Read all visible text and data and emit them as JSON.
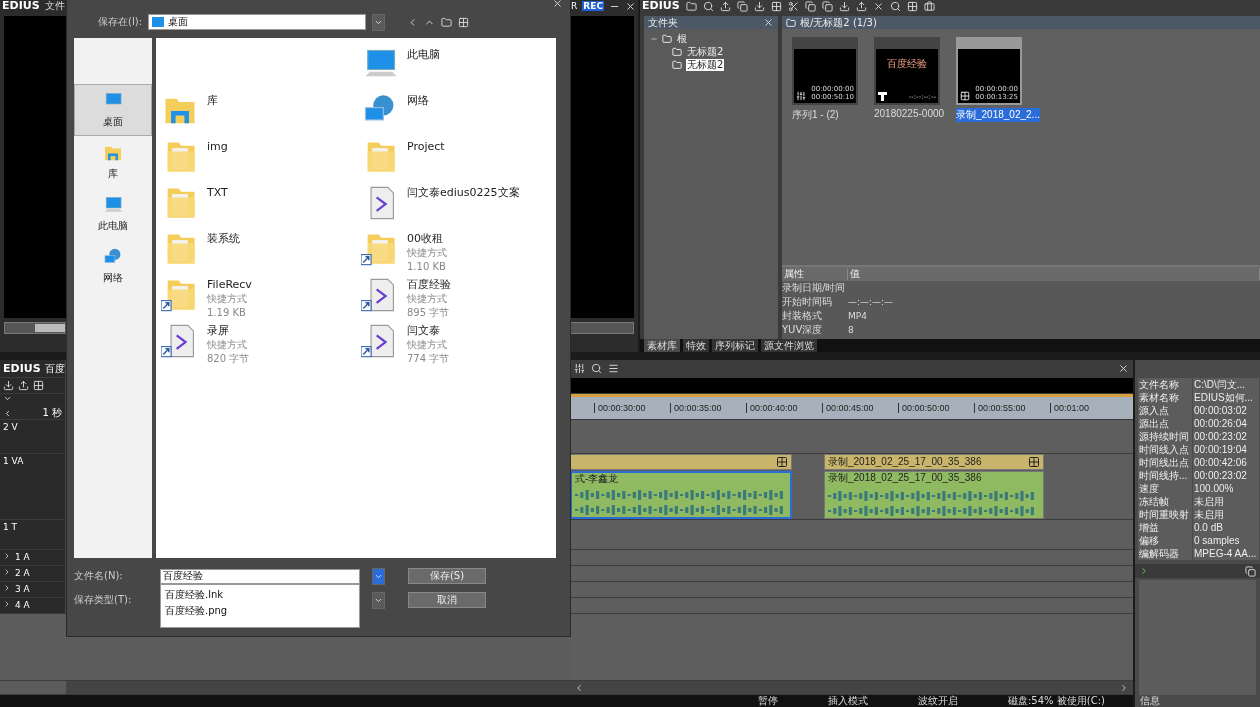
{
  "player": {
    "app_name": "EDIUS",
    "menu_label": "文件",
    "channel_label": "R",
    "rec_label": "REC"
  },
  "bin": {
    "app_name": "EDIUS",
    "folder_panel": {
      "title": "文件夹",
      "tree": [
        {
          "label": "根",
          "expanded": true,
          "selected": false,
          "children": [
            {
              "label": "无标题2",
              "selected": false
            },
            {
              "label": "无标题2",
              "selected": true
            }
          ]
        }
      ]
    },
    "path": "根/无标题2 (1/3)",
    "clips": [
      {
        "kind": "sequence",
        "name": "序列1 - (2)",
        "timecode_in": "00:00:00:00",
        "timecode_out": "00:00:50:10",
        "selected": false
      },
      {
        "kind": "title",
        "name": "20180225-0000",
        "caption": "百度经验",
        "timecode_out": "--:--:--:--",
        "selected": false
      },
      {
        "kind": "video",
        "name": "录制_2018_02_2...",
        "timecode_in": "00:00:00:00",
        "timecode_out": "00:00:13:25",
        "selected": true
      }
    ],
    "properties": {
      "columns": [
        "属性",
        "值"
      ],
      "rows": [
        {
          "name": "录制日期/时间"
        },
        {
          "name": "开始时间码",
          "value": "—:—:—:—"
        },
        {
          "name": "封装格式",
          "value": "MP4"
        },
        {
          "name": "YUV深度",
          "value": "8"
        }
      ]
    },
    "tabs": [
      {
        "label": "素材库",
        "selected": true
      },
      {
        "label": "特效",
        "selected": false
      },
      {
        "label": "序列标记",
        "selected": false
      },
      {
        "label": "源文件浏览",
        "selected": false
      }
    ]
  },
  "timeline": {
    "app_name": "EDIUS",
    "sequence_name": "百度",
    "scale": "1 秒",
    "ruler": [
      "00:00:30:00",
      "00:00:35:00",
      "00:00:40:00",
      "00:00:45:00",
      "00:00:50:00",
      "00:00:55:00",
      "00:01:00"
    ],
    "tracks": [
      {
        "kind": "video",
        "label": "2 V"
      },
      {
        "kind": "va",
        "label": "1 VA"
      },
      {
        "kind": "title",
        "label": "1 T"
      },
      {
        "kind": "audio",
        "label": "1 A"
      },
      {
        "kind": "audio",
        "label": "2 A"
      },
      {
        "kind": "audio",
        "label": "3 A"
      },
      {
        "kind": "audio",
        "label": "4 A"
      }
    ],
    "clips": [
      {
        "audio_name": "式-李鑫龙",
        "selected": true
      },
      {
        "video_name": "录制_2018_02_25_17_00_35_386",
        "audio_name": "录制_2018_02_25_17_00_35_386",
        "selected": false
      }
    ],
    "status": [
      "暂停",
      "插入模式",
      "波纹开启",
      "磁盘:54% 被使用(C:)"
    ]
  },
  "info": {
    "rows": [
      {
        "name": "文件名称",
        "value": "C:\\D\\闫文..."
      },
      {
        "name": "素材名称",
        "value": "EDIUS如何..."
      },
      {
        "name": "源入点",
        "value": "00:00:03:02"
      },
      {
        "name": "源出点",
        "value": "00:00:26:04"
      },
      {
        "name": "源持续时间",
        "value": "00:00:23:02"
      },
      {
        "name": "时间线入点",
        "value": "00:00:19:04"
      },
      {
        "name": "时间线出点",
        "value": "00:00:42:06"
      },
      {
        "name": "时间线持...",
        "value": "00:00:23:02"
      },
      {
        "name": "速度",
        "value": "100.00%"
      },
      {
        "name": "冻结帧",
        "value": "未启用"
      },
      {
        "name": "时间重映射",
        "value": "未启用"
      },
      {
        "name": "增益",
        "value": "0.0 dB"
      },
      {
        "name": "偏移",
        "value": "0 samples"
      },
      {
        "name": "编解码器",
        "value": "MPEG-4 AA..."
      }
    ],
    "tab": "信息"
  },
  "dialog": {
    "save_in_label": "保存在(I):",
    "save_in_value": "桌面",
    "places": [
      {
        "kind": "desktop",
        "label": "桌面",
        "selected": true
      },
      {
        "kind": "library",
        "label": "库",
        "selected": false
      },
      {
        "kind": "computer",
        "label": "此电脑",
        "selected": false
      },
      {
        "kind": "network",
        "label": "网络",
        "selected": false
      }
    ],
    "items": [
      {
        "kind": "computer",
        "name": "此电脑",
        "shortcut": false
      },
      {
        "kind": "library",
        "name": "库",
        "shortcut": false
      },
      {
        "kind": "network",
        "name": "网络",
        "shortcut": false
      },
      {
        "kind": "folder",
        "name": "img",
        "shortcut": false
      },
      {
        "kind": "folder",
        "name": "Project",
        "shortcut": false
      },
      {
        "kind": "folder",
        "name": "TXT",
        "shortcut": false
      },
      {
        "kind": "file",
        "name": "闫文泰edius0225文案",
        "shortcut": false
      },
      {
        "kind": "folder",
        "name": "装系统",
        "shortcut": false
      },
      {
        "kind": "folder",
        "name": "00收租",
        "shortcut": true,
        "type": "快捷方式",
        "size": "1.10 KB"
      },
      {
        "kind": "folder",
        "name": "FileRecv",
        "shortcut": true,
        "type": "快捷方式",
        "size": "1.19 KB"
      },
      {
        "kind": "file",
        "name": "百度经验",
        "shortcut": true,
        "type": "快捷方式",
        "size": "895 字节"
      },
      {
        "kind": "file",
        "name": "录屏",
        "shortcut": true,
        "type": "快捷方式",
        "size": "820 字节"
      },
      {
        "kind": "file",
        "name": "闫文泰",
        "shortcut": true,
        "type": "快捷方式",
        "size": "774 字节"
      }
    ],
    "file_name_label": "文件名(N):",
    "file_name_value": "百度经验",
    "suggestions": [
      "百度经验.lnk",
      "百度经验.png"
    ],
    "file_type_label": "保存类型(T):",
    "buttons": [
      "保存(S)",
      "取消"
    ]
  }
}
